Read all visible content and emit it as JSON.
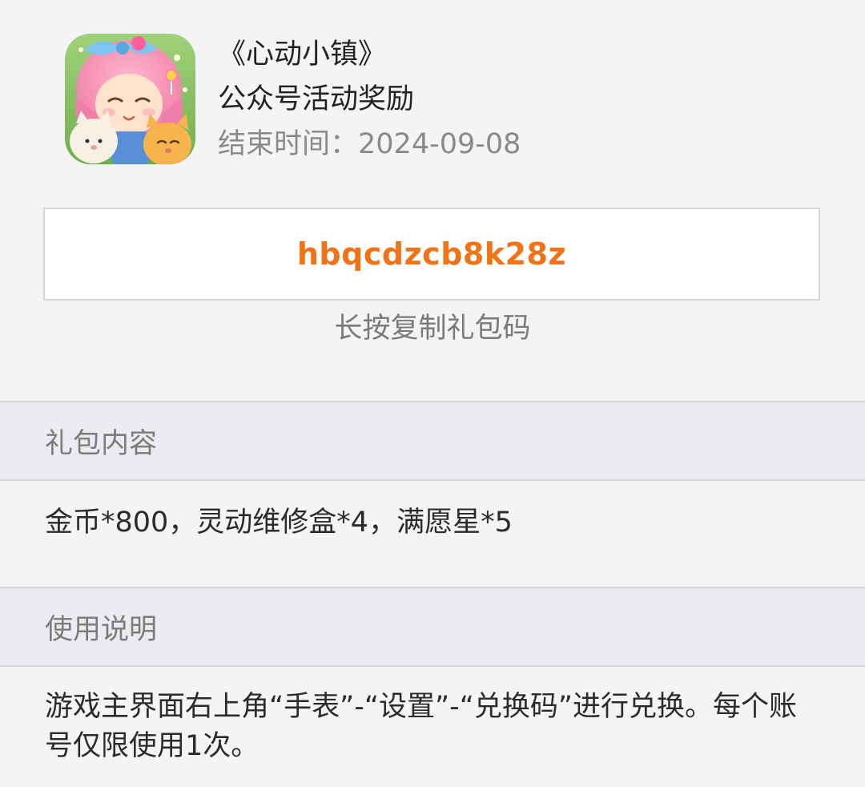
{
  "game": {
    "title": "《心动小镇》",
    "event": "公众号活动奖励",
    "end_label": "结束时间：",
    "end_date": "2024-09-08",
    "icon": "game-app-icon"
  },
  "gift": {
    "code": "hbqcdzcb8k28z",
    "copy_hint": "长按复制礼包码",
    "code_color": "#f07317"
  },
  "sections": {
    "contents": {
      "heading": "礼包内容",
      "text": "金币*800，灵动维修盒*4，满愿星*5"
    },
    "instructions": {
      "heading": "使用说明",
      "text": "游戏主界面右上角“手表”-“设置”-“兑换码”进行兑换。每个账号仅限使用1次。"
    }
  }
}
